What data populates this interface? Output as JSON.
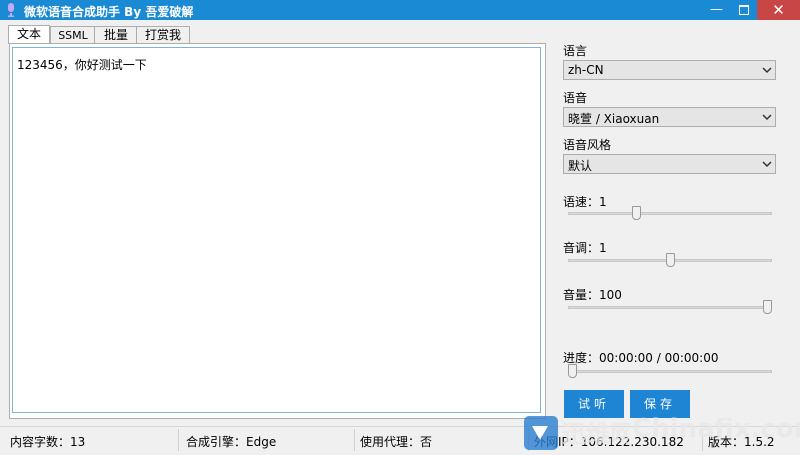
{
  "window": {
    "title": "微软语音合成助手 By 吾爱破解",
    "minimize_glyph": "—",
    "close_glyph": "✕"
  },
  "tabs": [
    {
      "label": "文本",
      "active": true
    },
    {
      "label": "SSML",
      "active": false
    },
    {
      "label": "批量",
      "active": false
    },
    {
      "label": "打赏我",
      "active": false
    }
  ],
  "editor": {
    "text": "123456，你好测试一下"
  },
  "settings": {
    "language": {
      "label": "语言",
      "value": "zh-CN"
    },
    "voice": {
      "label": "语音",
      "value": "晓萱 / Xiaoxuan"
    },
    "style": {
      "label": "语音风格",
      "value": "默认"
    },
    "speed": {
      "label": "语速：1",
      "value": 0.33
    },
    "pitch": {
      "label": "音调：1",
      "value": 0.5
    },
    "volume": {
      "label": "音量：100",
      "value": 1.0
    },
    "progress": {
      "label": "进度：00:00:00 / 00:00:00",
      "value": 0.0
    }
  },
  "buttons": {
    "preview": "试听",
    "save": "保存"
  },
  "status": {
    "char_count": "内容字数：13",
    "engine": "合成引擎：Edge",
    "proxy": "使用代理：否",
    "ip": "外网IP：106.122.230.182",
    "version": "版本：1.5.2"
  },
  "watermark": {
    "text": "Chinafix.com"
  },
  "colors": {
    "titlebar": "#1a8ad4",
    "close": "#c94646",
    "accent_button": "#1d85d4"
  }
}
